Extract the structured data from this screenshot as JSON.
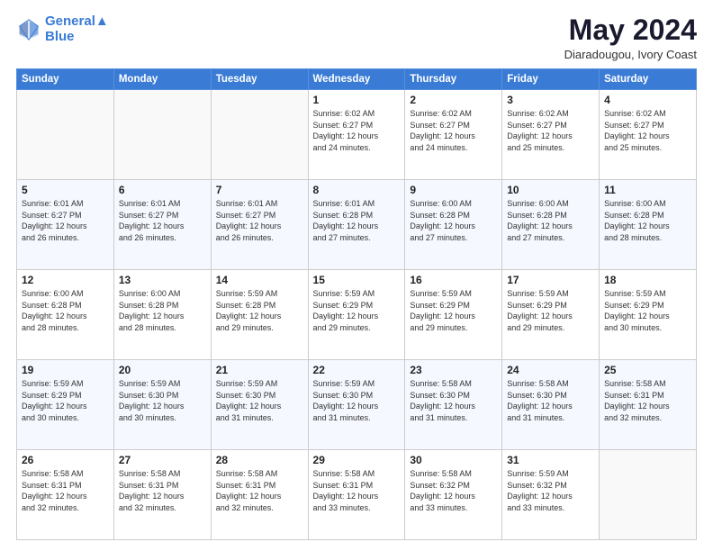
{
  "header": {
    "logo_line1": "General",
    "logo_line2": "Blue",
    "title": "May 2024",
    "subtitle": "Diaradougou, Ivory Coast"
  },
  "weekdays": [
    "Sunday",
    "Monday",
    "Tuesday",
    "Wednesday",
    "Thursday",
    "Friday",
    "Saturday"
  ],
  "weeks": [
    [
      {
        "day": "",
        "info": ""
      },
      {
        "day": "",
        "info": ""
      },
      {
        "day": "",
        "info": ""
      },
      {
        "day": "1",
        "info": "Sunrise: 6:02 AM\nSunset: 6:27 PM\nDaylight: 12 hours\nand 24 minutes."
      },
      {
        "day": "2",
        "info": "Sunrise: 6:02 AM\nSunset: 6:27 PM\nDaylight: 12 hours\nand 24 minutes."
      },
      {
        "day": "3",
        "info": "Sunrise: 6:02 AM\nSunset: 6:27 PM\nDaylight: 12 hours\nand 25 minutes."
      },
      {
        "day": "4",
        "info": "Sunrise: 6:02 AM\nSunset: 6:27 PM\nDaylight: 12 hours\nand 25 minutes."
      }
    ],
    [
      {
        "day": "5",
        "info": "Sunrise: 6:01 AM\nSunset: 6:27 PM\nDaylight: 12 hours\nand 26 minutes."
      },
      {
        "day": "6",
        "info": "Sunrise: 6:01 AM\nSunset: 6:27 PM\nDaylight: 12 hours\nand 26 minutes."
      },
      {
        "day": "7",
        "info": "Sunrise: 6:01 AM\nSunset: 6:27 PM\nDaylight: 12 hours\nand 26 minutes."
      },
      {
        "day": "8",
        "info": "Sunrise: 6:01 AM\nSunset: 6:28 PM\nDaylight: 12 hours\nand 27 minutes."
      },
      {
        "day": "9",
        "info": "Sunrise: 6:00 AM\nSunset: 6:28 PM\nDaylight: 12 hours\nand 27 minutes."
      },
      {
        "day": "10",
        "info": "Sunrise: 6:00 AM\nSunset: 6:28 PM\nDaylight: 12 hours\nand 27 minutes."
      },
      {
        "day": "11",
        "info": "Sunrise: 6:00 AM\nSunset: 6:28 PM\nDaylight: 12 hours\nand 28 minutes."
      }
    ],
    [
      {
        "day": "12",
        "info": "Sunrise: 6:00 AM\nSunset: 6:28 PM\nDaylight: 12 hours\nand 28 minutes."
      },
      {
        "day": "13",
        "info": "Sunrise: 6:00 AM\nSunset: 6:28 PM\nDaylight: 12 hours\nand 28 minutes."
      },
      {
        "day": "14",
        "info": "Sunrise: 5:59 AM\nSunset: 6:28 PM\nDaylight: 12 hours\nand 29 minutes."
      },
      {
        "day": "15",
        "info": "Sunrise: 5:59 AM\nSunset: 6:29 PM\nDaylight: 12 hours\nand 29 minutes."
      },
      {
        "day": "16",
        "info": "Sunrise: 5:59 AM\nSunset: 6:29 PM\nDaylight: 12 hours\nand 29 minutes."
      },
      {
        "day": "17",
        "info": "Sunrise: 5:59 AM\nSunset: 6:29 PM\nDaylight: 12 hours\nand 29 minutes."
      },
      {
        "day": "18",
        "info": "Sunrise: 5:59 AM\nSunset: 6:29 PM\nDaylight: 12 hours\nand 30 minutes."
      }
    ],
    [
      {
        "day": "19",
        "info": "Sunrise: 5:59 AM\nSunset: 6:29 PM\nDaylight: 12 hours\nand 30 minutes."
      },
      {
        "day": "20",
        "info": "Sunrise: 5:59 AM\nSunset: 6:30 PM\nDaylight: 12 hours\nand 30 minutes."
      },
      {
        "day": "21",
        "info": "Sunrise: 5:59 AM\nSunset: 6:30 PM\nDaylight: 12 hours\nand 31 minutes."
      },
      {
        "day": "22",
        "info": "Sunrise: 5:59 AM\nSunset: 6:30 PM\nDaylight: 12 hours\nand 31 minutes."
      },
      {
        "day": "23",
        "info": "Sunrise: 5:58 AM\nSunset: 6:30 PM\nDaylight: 12 hours\nand 31 minutes."
      },
      {
        "day": "24",
        "info": "Sunrise: 5:58 AM\nSunset: 6:30 PM\nDaylight: 12 hours\nand 31 minutes."
      },
      {
        "day": "25",
        "info": "Sunrise: 5:58 AM\nSunset: 6:31 PM\nDaylight: 12 hours\nand 32 minutes."
      }
    ],
    [
      {
        "day": "26",
        "info": "Sunrise: 5:58 AM\nSunset: 6:31 PM\nDaylight: 12 hours\nand 32 minutes."
      },
      {
        "day": "27",
        "info": "Sunrise: 5:58 AM\nSunset: 6:31 PM\nDaylight: 12 hours\nand 32 minutes."
      },
      {
        "day": "28",
        "info": "Sunrise: 5:58 AM\nSunset: 6:31 PM\nDaylight: 12 hours\nand 32 minutes."
      },
      {
        "day": "29",
        "info": "Sunrise: 5:58 AM\nSunset: 6:31 PM\nDaylight: 12 hours\nand 33 minutes."
      },
      {
        "day": "30",
        "info": "Sunrise: 5:58 AM\nSunset: 6:32 PM\nDaylight: 12 hours\nand 33 minutes."
      },
      {
        "day": "31",
        "info": "Sunrise: 5:59 AM\nSunset: 6:32 PM\nDaylight: 12 hours\nand 33 minutes."
      },
      {
        "day": "",
        "info": ""
      }
    ]
  ]
}
